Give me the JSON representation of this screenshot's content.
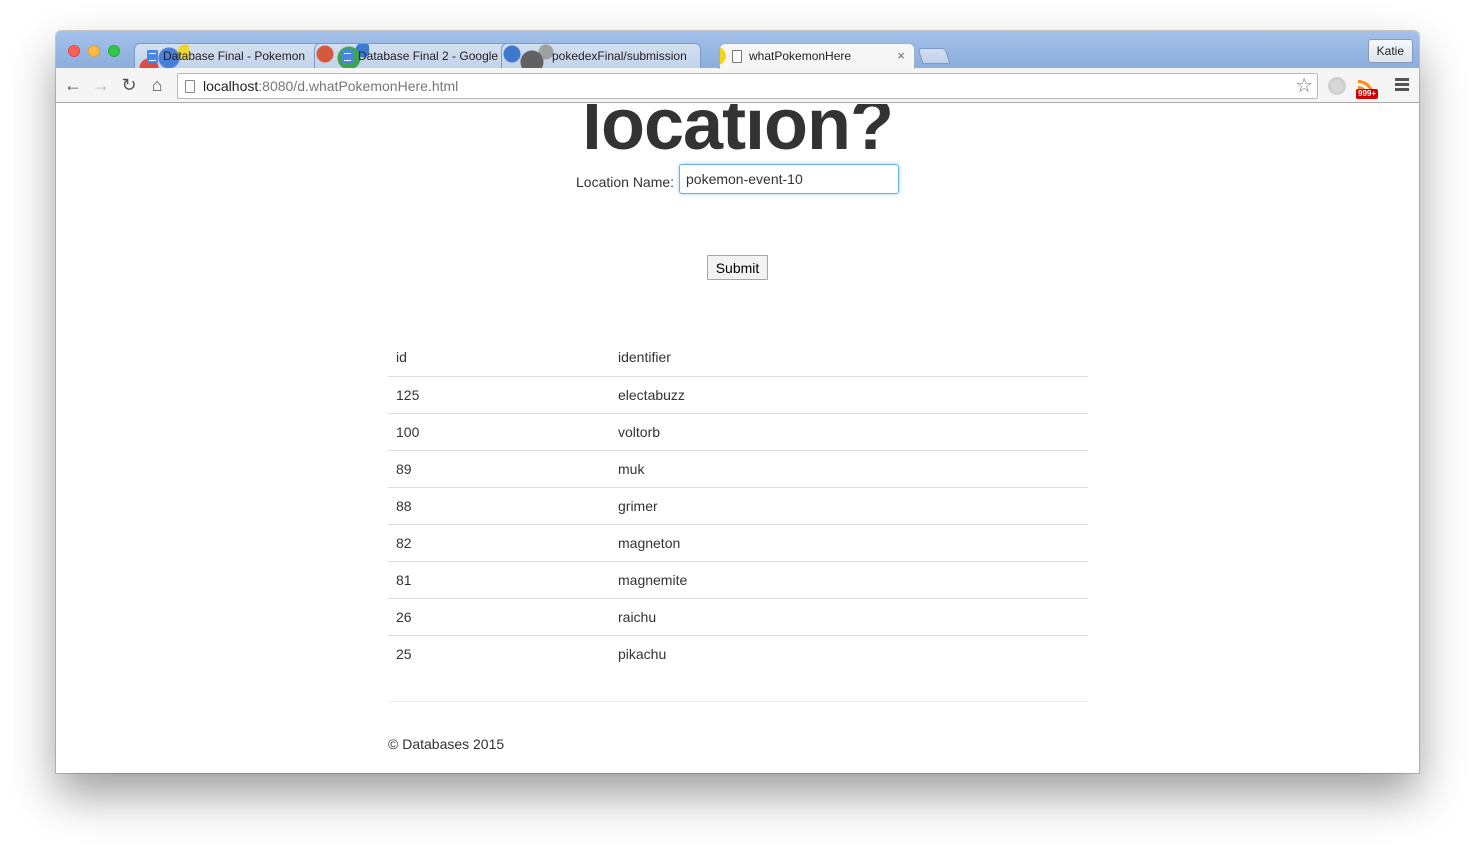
{
  "browser": {
    "tabs": [
      {
        "title": "Database Final - Pokemon",
        "active": false
      },
      {
        "title": "Database Final 2 - Google",
        "active": false
      },
      {
        "title": "pokedexFinal/submission",
        "active": false
      },
      {
        "title": "whatPokemonHere",
        "active": true
      }
    ],
    "profile_name": "Katie",
    "url_host": "localhost",
    "url_rest": ":8080/d.whatPokemonHere.html",
    "extension_badge": "999+",
    "accent_color": "#95b5e0"
  },
  "page": {
    "heading": "location?",
    "form": {
      "label": "Location Name:",
      "value": "pokemon-event-10",
      "submit_label": "Submit"
    },
    "table": {
      "headers": [
        "id",
        "identifier"
      ],
      "rows": [
        [
          "125",
          "electabuzz"
        ],
        [
          "100",
          "voltorb"
        ],
        [
          "89",
          "muk"
        ],
        [
          "88",
          "grimer"
        ],
        [
          "82",
          "magneton"
        ],
        [
          "81",
          "magnemite"
        ],
        [
          "26",
          "raichu"
        ],
        [
          "25",
          "pikachu"
        ]
      ]
    },
    "footer": "© Databases 2015"
  }
}
